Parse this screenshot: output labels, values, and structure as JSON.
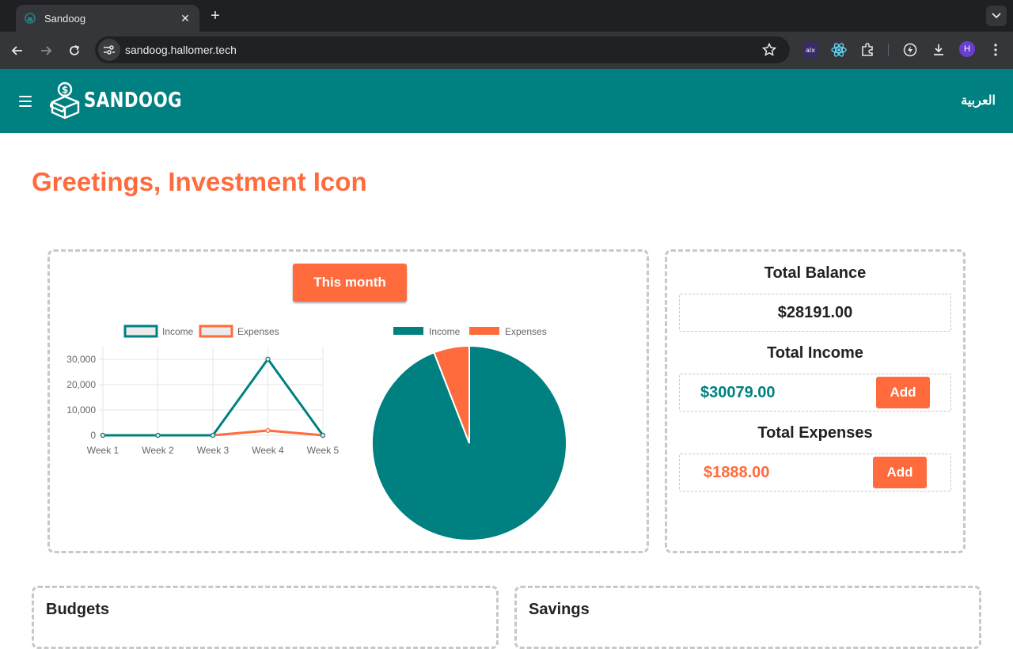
{
  "browser": {
    "tab_title": "Sandoog",
    "url": "sandoog.hallomer.tech",
    "profile_initial": "H",
    "extensions": [
      "alx-extension-icon",
      "react-devtools-icon",
      "puzzle-icon",
      "lightning-icon",
      "download-icon"
    ]
  },
  "header": {
    "logo_text": "SANDOOG",
    "language_label": "العربية"
  },
  "greeting": "Greetings, Investment Icon",
  "chart_card": {
    "period_button": "This month"
  },
  "totals": {
    "balance_title": "Total Balance",
    "balance_value": "$28191.00",
    "income_title": "Total Income",
    "income_value": "$30079.00",
    "income_add": "Add",
    "expenses_title": "Total Expenses",
    "expenses_value": "$1888.00",
    "expenses_add": "Add"
  },
  "sections": {
    "budgets": "Budgets",
    "savings": "Savings"
  },
  "colors": {
    "teal": "#008080",
    "orange": "#ff6b3d"
  },
  "chart_data": [
    {
      "type": "line",
      "categories": [
        "Week 1",
        "Week 2",
        "Week 3",
        "Week 4",
        "Week 5"
      ],
      "series": [
        {
          "name": "Income",
          "values": [
            0,
            0,
            0,
            30079,
            0
          ],
          "color": "#008080"
        },
        {
          "name": "Expenses",
          "values": [
            0,
            0,
            0,
            1888,
            0
          ],
          "color": "#ff6b3d"
        }
      ],
      "yticks": [
        "0",
        "10,000",
        "20,000",
        "30,000"
      ],
      "ylim": [
        0,
        35000
      ],
      "grid": true,
      "legend": "top"
    },
    {
      "type": "pie",
      "labels": [
        "Income",
        "Expenses"
      ],
      "values": [
        30079,
        1888
      ],
      "colors": [
        "#008080",
        "#ff6b3d"
      ],
      "legend": "top"
    }
  ]
}
